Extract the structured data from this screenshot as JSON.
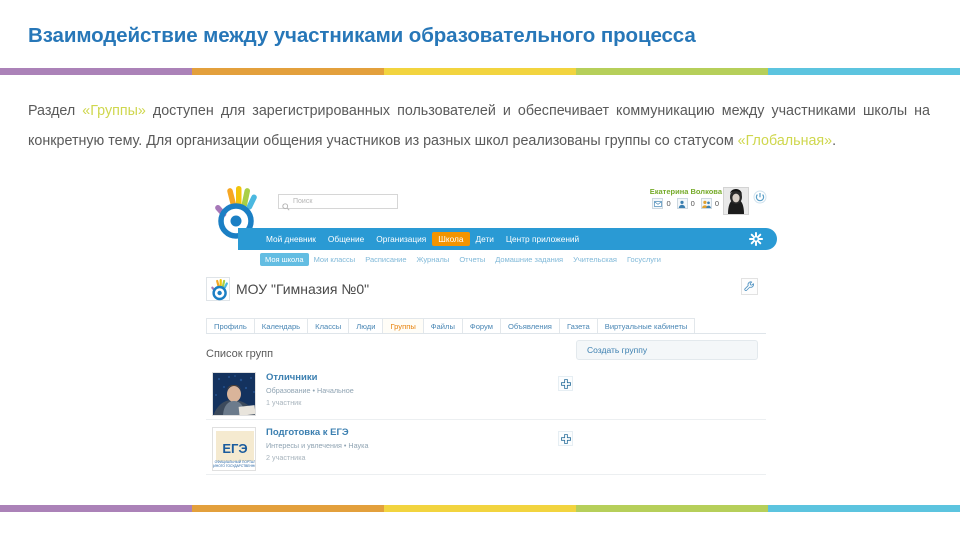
{
  "slide": {
    "title": "Взаимодействие между участниками образовательного процесса",
    "title_color": "#2777b8",
    "body_parts": {
      "p1": "Раздел ",
      "hl1": "«Группы»",
      "p2": " доступен для зарегистрированных пользователей и обеспечивает коммуникацию между участниками школы на конкретную тему. Для организации общения участников из разных школ реализованы группы со статусом ",
      "hl2": "«Глобальная»",
      "p3": "."
    },
    "rule_colors": [
      "#ab82b8",
      "#e3a03c",
      "#f2d43f",
      "#b6cf5a",
      "#5cc4df"
    ]
  },
  "screenshot": {
    "logo_name": "dnevnik-logo",
    "search": {
      "placeholder": "Поиск",
      "value": "",
      "icon": "search-icon"
    },
    "user": {
      "name": "Екатерина Волкова",
      "name_color": "#76ab2a",
      "counters": [
        {
          "icon": "mail-icon",
          "count": "0"
        },
        {
          "icon": "user-icon",
          "count": "0"
        },
        {
          "icon": "friends-icon",
          "count": "0"
        }
      ],
      "avatar_name": "user-avatar",
      "logout_icon": "power-icon"
    },
    "nav_primary": {
      "active_color": "#f29400",
      "bar_color": "#2a9ad4",
      "items": [
        {
          "label": "Мой дневник",
          "active": false
        },
        {
          "label": "Общение",
          "active": false
        },
        {
          "label": "Организация",
          "active": false
        },
        {
          "label": "Школа",
          "active": true
        },
        {
          "label": "Дети",
          "active": false
        },
        {
          "label": "Центр приложений",
          "active": false
        }
      ],
      "settings_icon": "gear-icon"
    },
    "nav_secondary": {
      "active_color": "#63bde2",
      "items": [
        {
          "label": "Моя школа",
          "active": true
        },
        {
          "label": "Мои классы",
          "active": false
        },
        {
          "label": "Расписание",
          "active": false
        },
        {
          "label": "Журналы",
          "active": false
        },
        {
          "label": "Отчеты",
          "active": false
        },
        {
          "label": "Домашние задания",
          "active": false
        },
        {
          "label": "Учительская",
          "active": false
        },
        {
          "label": "Госуслуги",
          "active": false
        }
      ]
    },
    "school": {
      "name": "МОУ \"Гимназия №0\"",
      "badge_name": "school-badge-icon",
      "settings_icon": "wrench-icon"
    },
    "tabs": [
      {
        "label": "Профиль",
        "active": false
      },
      {
        "label": "Календарь",
        "active": false
      },
      {
        "label": "Классы",
        "active": false
      },
      {
        "label": "Люди",
        "active": false
      },
      {
        "label": "Группы",
        "active": true
      },
      {
        "label": "Файлы",
        "active": false
      },
      {
        "label": "Форум",
        "active": false
      },
      {
        "label": "Объявления",
        "active": false
      },
      {
        "label": "Газета",
        "active": false
      },
      {
        "label": "Виртуальные кабинеты",
        "active": false
      }
    ],
    "groups_panel": {
      "title": "Список групп",
      "create_button": "Создать группу",
      "items": [
        {
          "name": "Отличники",
          "category": "Образование • Начальное",
          "members": "1 участник",
          "thumb_name": "group-thumbnail-photo",
          "add_icon": "plus-icon"
        },
        {
          "name": "Подготовка к ЕГЭ",
          "category": "Интересы и увлечения • Наука",
          "members": "2 участника",
          "thumb_name": "group-thumbnail-ege",
          "thumb_text": "ЕГЭ",
          "thumb_subtext": "официальный портал единого государственного экзамена",
          "add_icon": "plus-icon"
        }
      ]
    }
  }
}
